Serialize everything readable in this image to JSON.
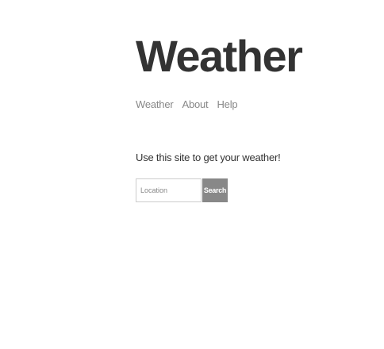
{
  "header": {
    "title": "Weather"
  },
  "nav": {
    "items": [
      {
        "label": "Weather"
      },
      {
        "label": "About"
      },
      {
        "label": "Help"
      }
    ]
  },
  "main": {
    "intro": "Use this site to get your weather!",
    "search": {
      "placeholder": "Location",
      "value": "",
      "button_label": "Search"
    }
  },
  "colors": {
    "text": "#333333",
    "muted": "#888888",
    "button_bg": "#888888",
    "button_text": "#ffffff",
    "input_border": "#cccccc"
  }
}
